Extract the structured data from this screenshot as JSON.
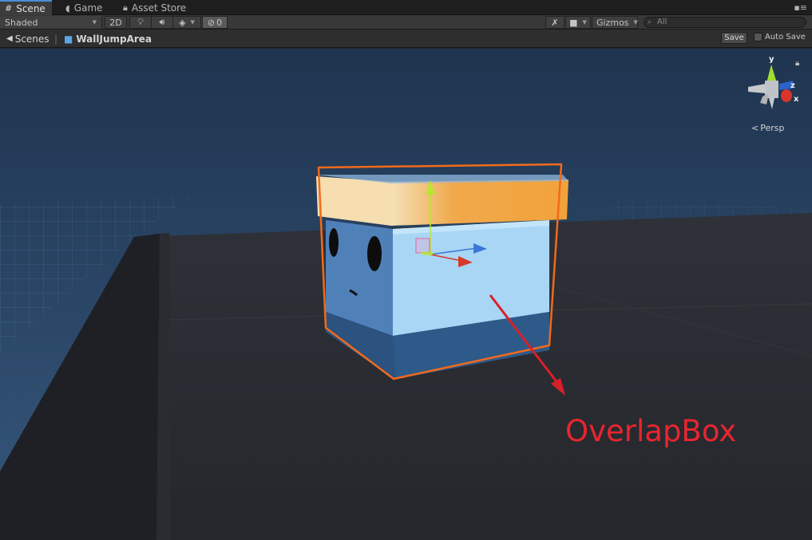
{
  "tabs": [
    {
      "label": "Scene",
      "icon": "grid-icon",
      "active": true
    },
    {
      "label": "Game",
      "icon": "pacman-icon",
      "active": false
    },
    {
      "label": "Asset Store",
      "icon": "lock-icon",
      "active": false
    }
  ],
  "toolbar": {
    "shading_mode": "Shaded",
    "mode_2d": "2D",
    "hidden_count": "0",
    "gizmos_label": "Gizmos",
    "search_placeholder": "All"
  },
  "breadcrumb": {
    "root": "Scenes",
    "current": "WallJumpArea"
  },
  "actions": {
    "save_label": "Save",
    "autosave_label": "Auto Save"
  },
  "viewport": {
    "projection": "Persp",
    "axis_labels": {
      "y": "y",
      "z": "z",
      "x": "x"
    },
    "annotation": "OverlapBox",
    "colors": {
      "sky": "#2e4a6b",
      "ground": "#2a2d33",
      "selection_outline": "#f26a1b",
      "annotation": "#e8252e",
      "agent_top": "#f0a23c",
      "agent_face": "#a9d6f5"
    }
  }
}
